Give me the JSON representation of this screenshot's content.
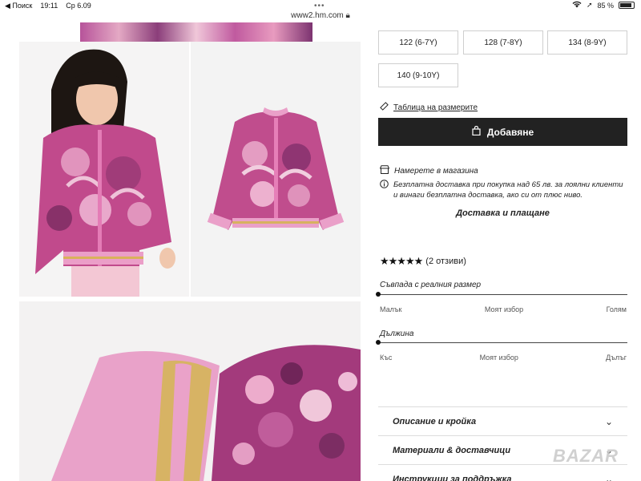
{
  "status": {
    "back_label": "◀ Поиск",
    "time": "19:11",
    "date": "Ср 6.09",
    "url": "www2.hm.com",
    "battery": "85 %",
    "battery_fraction": 0.85
  },
  "sizes": [
    "122 (6-7Y)",
    "128 (7-8Y)",
    "134 (8-9Y)",
    "140 (9-10Y)"
  ],
  "size_guide_label": "Таблица на размерите",
  "add_button_label": "Добавяне",
  "store_label": "Намерете в магазина",
  "info_text": "Безплатна доставка при покупка над 65 лв. за лоялни клиенти и винаги безплатна доставка, ако си от плюс ниво.",
  "delivery_link": "Доставка и плащане",
  "rating": {
    "stars": "★★★★★",
    "count_label": "(2 отзиви)"
  },
  "fit": [
    {
      "title": "Съвпада с реалния размер",
      "labels": [
        "Малък",
        "Моят избор",
        "Голям"
      ]
    },
    {
      "title": "Дължина",
      "labels": [
        "Къс",
        "Моят избор",
        "Дълъг"
      ]
    }
  ],
  "accordion": [
    "Описание и кройка",
    "Материали & доставчици",
    "Инструкции за поддръжка"
  ],
  "watermark": "BAZAR"
}
